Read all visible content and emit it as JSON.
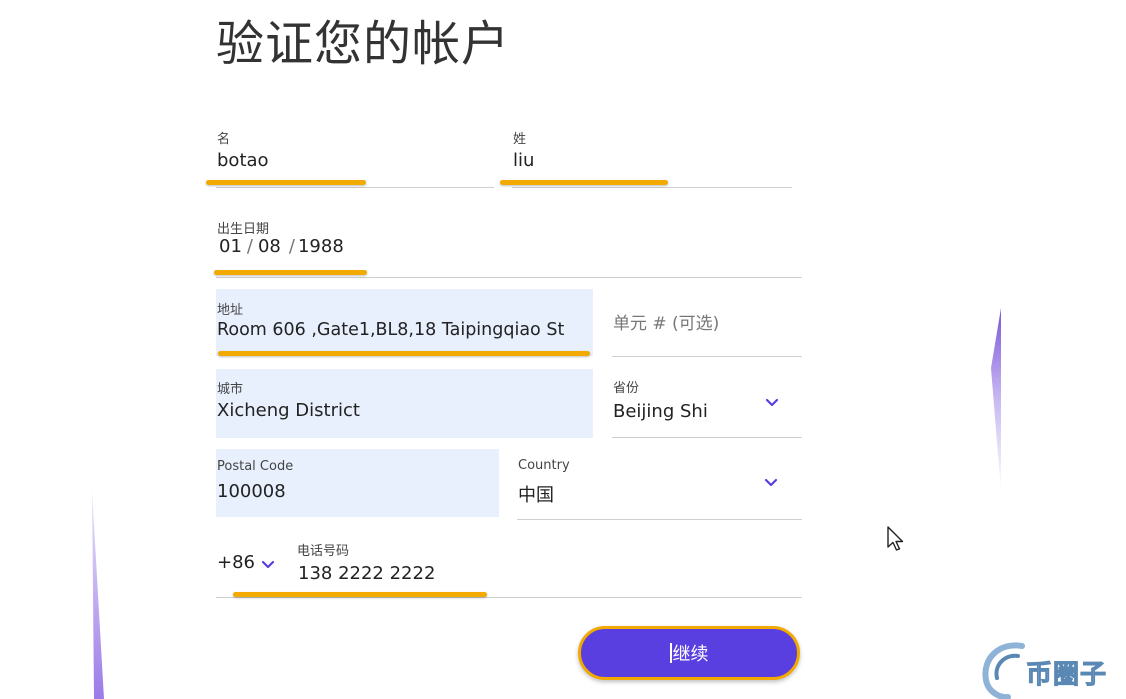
{
  "page": {
    "title": "验证您的帐户"
  },
  "form": {
    "first_name": {
      "label": "名",
      "value": "botao"
    },
    "last_name": {
      "label": "姓",
      "value": "liu"
    },
    "dob": {
      "label": "出生日期",
      "day": "01",
      "month": "08",
      "year": "1988",
      "sep": "/"
    },
    "address": {
      "label": "地址",
      "value": "Room 606 ,Gate1,BL8,18 Taipingqiao St"
    },
    "unit": {
      "placeholder": "单元 # (可选)"
    },
    "city": {
      "label": "城市",
      "value": "Xicheng District"
    },
    "province": {
      "label": "省份",
      "value": "Beijing Shi"
    },
    "postal": {
      "label": "Postal Code",
      "value": "100008"
    },
    "country": {
      "label": "Country",
      "value": "中国"
    },
    "phone": {
      "country_code": "+86",
      "label": "电话号码",
      "value": "138  2222  2222"
    }
  },
  "actions": {
    "continue_label": "继续"
  },
  "watermark": {
    "text": "币圈子"
  },
  "colors": {
    "accent": "#5a3fe0",
    "highlight": "#f2a900",
    "autofill": "#e8f0fe",
    "chevron": "#5a3fe0"
  },
  "icons": {
    "dropdown": "chevron-down-icon",
    "cursor": "mouse-pointer-icon"
  }
}
